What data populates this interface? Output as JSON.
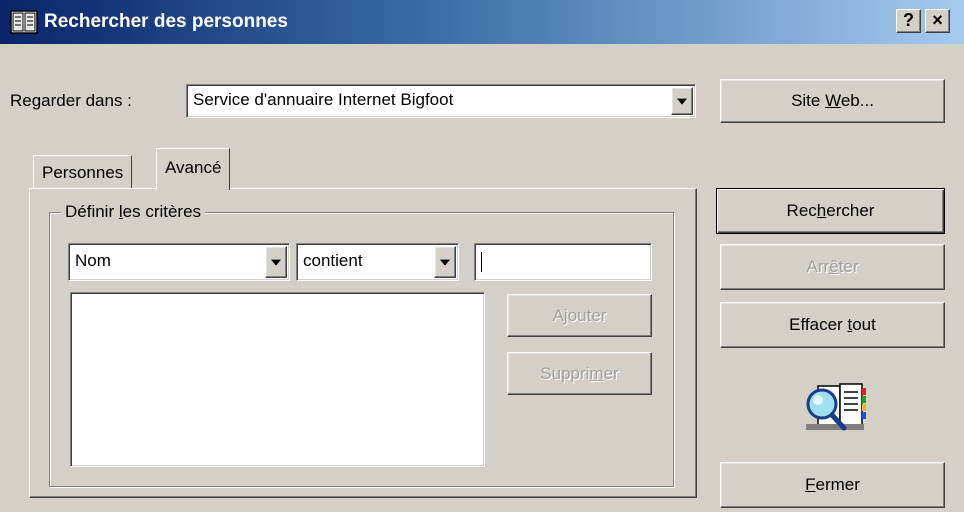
{
  "window": {
    "title": "Rechercher des personnes",
    "help_button": "?",
    "close_button": "×"
  },
  "look_in": {
    "label": "Regarder dans :",
    "selected": "Service d'annuaire Internet Bigfoot"
  },
  "buttons": {
    "website": {
      "pre": "Site ",
      "accel": "W",
      "post": "eb..."
    },
    "search": {
      "pre": "Rec",
      "accel": "h",
      "post": "ercher"
    },
    "stop": {
      "pre": "Arr",
      "accel": "ê",
      "post": "ter"
    },
    "clear_all": {
      "pre": "Effacer ",
      "accel": "t",
      "post": "out"
    },
    "close": {
      "pre": "",
      "accel": "F",
      "post": "ermer"
    },
    "add": {
      "pre": "A",
      "accel": "j",
      "post": "outer"
    },
    "remove": {
      "pre": "Suppri",
      "accel": "m",
      "post": "er"
    }
  },
  "tabs": [
    {
      "label": "Personnes",
      "active": false
    },
    {
      "label": "Avancé",
      "active": true
    }
  ],
  "criteria": {
    "legend": {
      "pre": "Définir ",
      "accel": "l",
      "post": "es critères"
    },
    "field_select": "Nom",
    "operator_select": "contient",
    "value_input": "",
    "criteria_list": []
  },
  "icons": {
    "title": "address-book-icon",
    "search_animation": "address-book-magnifier-icon"
  },
  "colors": {
    "titlebar_start": "#0a246a",
    "titlebar_end": "#a6caf0",
    "face": "#d4d0c8",
    "disabled_text": "#a0a0a0"
  }
}
